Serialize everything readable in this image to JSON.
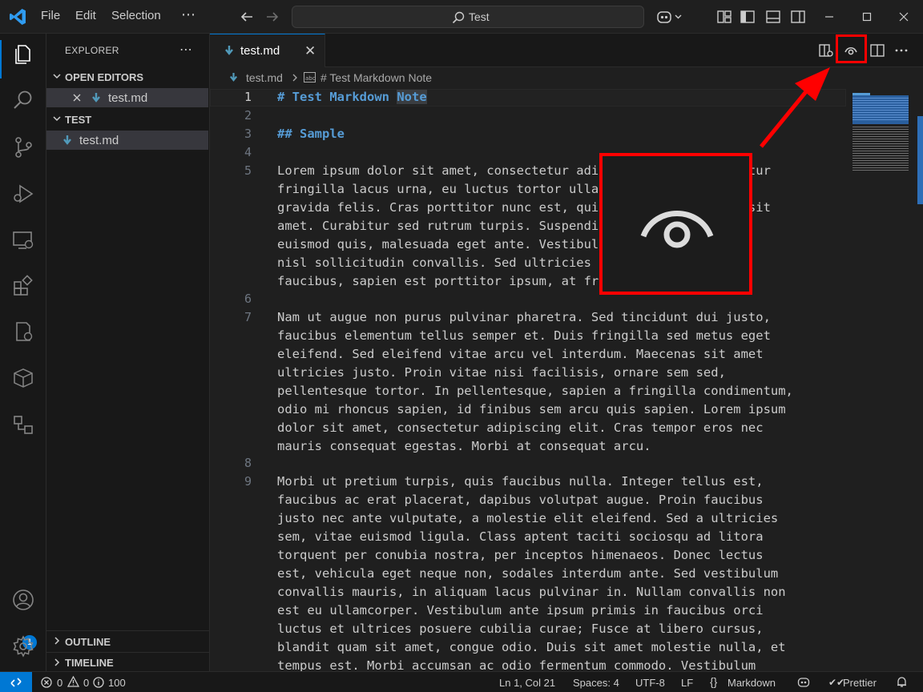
{
  "menu": {
    "file": "File",
    "edit": "Edit",
    "selection": "Selection",
    "more": "⋯"
  },
  "command_center": {
    "text": "Test"
  },
  "sidebar": {
    "title": "EXPLORER",
    "more": "⋯",
    "open_editors": "OPEN EDITORS",
    "open_file": "test.md",
    "folder": "TEST",
    "folder_file": "test.md",
    "outline": "OUTLINE",
    "timeline": "TIMELINE"
  },
  "accounts_badge": "1",
  "tab": {
    "label": "test.md",
    "close": "✕"
  },
  "breadcrumb": {
    "file": "test.md",
    "symbol": "# Test Markdown Note"
  },
  "editor": {
    "line_numbers": [
      "1",
      "2",
      "3",
      "4",
      "5",
      "6",
      "7",
      "8",
      "9"
    ],
    "heading1": "# Test Markdown",
    "heading1_tail": "Note",
    "heading2": "## Sample",
    "para1": [
      "Lorem ipsum dolor sit amet, consectetur adipiscing elit. Curabitur",
      "fringilla lacus urna, eu luctus tortor ullamcorper et. Dapibus",
      "gravida felis. Cras porttitor nunc est, quis imperdiet aliquam sit",
      "amet. Curabitur sed rutrum turpis. Suspendisse potenti et",
      "euismod quis, malesuada eget ante. Vestibulum ante vestibulum",
      "nisl sollicitudin convallis. Sed ultricies ullamcorper",
      "faucibus, sapien est porttitor ipsum, at fringilla eu nulla."
    ],
    "para2": [
      "Nam ut augue non purus pulvinar pharetra. Sed tincidunt dui justo,",
      "faucibus elementum tellus semper et. Duis fringilla sed metus eget",
      "eleifend. Sed eleifend vitae arcu vel interdum. Maecenas sit amet",
      "ultricies justo. Proin vitae nisi facilisis, ornare sem sed,",
      "pellentesque tortor. In pellentesque, sapien a fringilla condimentum,",
      "odio mi rhoncus sapien, id finibus sem arcu quis sapien. Lorem ipsum",
      "dolor sit amet, consectetur adipiscing elit. Cras tempor eros nec",
      "mauris consequat egestas. Morbi at consequat arcu."
    ],
    "para3": [
      "Morbi ut pretium turpis, quis faucibus nulla. Integer tellus est,",
      "faucibus ac erat placerat, dapibus volutpat augue. Proin faucibus",
      "justo nec ante vulputate, a molestie elit eleifend. Sed a ultricies",
      "sem, vitae euismod ligula. Class aptent taciti sociosqu ad litora",
      "torquent per conubia nostra, per inceptos himenaeos. Donec lectus",
      "est, vehicula eget neque non, sodales interdum ante. Sed vestibulum",
      "convallis mauris, in aliquam lacus pulvinar in. Nullam convallis non",
      "est eu ullamcorper. Vestibulum ante ipsum primis in faucibus orci",
      "luctus et ultrices posuere cubilia curae; Fusce at libero cursus,",
      "blandit quam sit amet, congue odio. Duis sit amet molestie nulla, et",
      "tempus est. Morbi accumsan ac odio fermentum commodo. Vestibulum"
    ]
  },
  "status": {
    "errors": "0",
    "warnings": "0",
    "info": "100",
    "position": "Ln 1, Col 21",
    "spaces": "Spaces: 4",
    "encoding": "UTF-8",
    "eol": "LF",
    "language": "Markdown",
    "prettier": "Prettier"
  },
  "colors": {
    "accent": "#0078d4",
    "annotation": "#ff0000",
    "heading": "#569cd6"
  }
}
